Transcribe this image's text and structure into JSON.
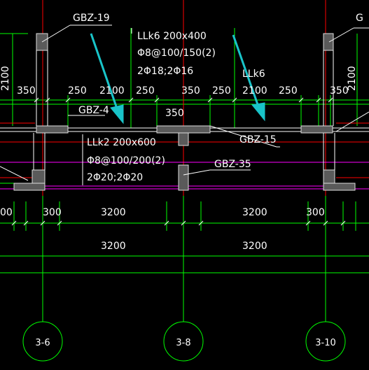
{
  "colors": {
    "background": "#000000",
    "text": "#ffffff",
    "grid_green": "#00ff00",
    "axis_red": "#ff0000",
    "beam_magenta": "#ff00ff",
    "wall_fill": "#5a5a5a",
    "arrow_cyan": "#19c4c9"
  },
  "labels": {
    "gbz_19": "GBZ-19",
    "gbz_4": "GBZ-4",
    "gbz_15": "GBZ-15",
    "gbz_35": "GBZ-35",
    "gbz_right": "G",
    "llk6_a": "LLk6 200x400",
    "llk6_b": "Φ8@100/150(2)",
    "llk6_c": "2Φ18;2Φ16",
    "llk6_short": "LLk6",
    "llk2_a": "LLk2 200x600",
    "llk2_b": "Φ8@100/200(2)",
    "llk2_c": "2Φ20;2Φ20"
  },
  "dims": {
    "d350_left": "350",
    "d250_1": "250",
    "d2100_1": "2100",
    "d250_2": "250",
    "d350_mid": "350",
    "d250_3": "250",
    "d2100_2": "2100",
    "d250_4": "250",
    "d350_right": "350",
    "d350_center": "350",
    "v2100_left": "2100",
    "v2100_right": "2100",
    "d300_edge": "00",
    "d300_a": "300",
    "d3200_a": "3200",
    "d3200_b": "3200",
    "d300_b": "300",
    "d3200_total_a": "3200",
    "d3200_total_b": "3200"
  },
  "axes": {
    "a1": "3-6",
    "a2": "3-8",
    "a3": "3-10"
  }
}
